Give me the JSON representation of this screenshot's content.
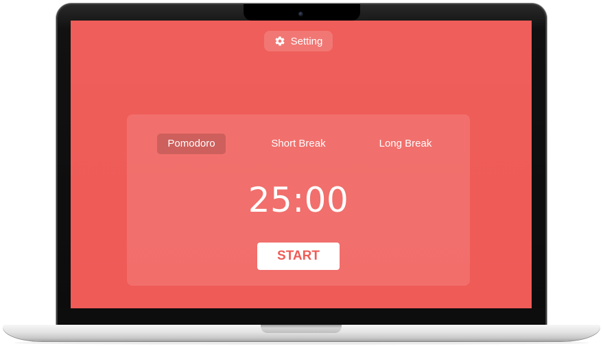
{
  "app": {
    "accent_color": "#ef5b57",
    "setting_label": "Setting",
    "setting_icon": "gear-icon"
  },
  "timer": {
    "tabs": [
      {
        "label": "Pomodoro",
        "active": true
      },
      {
        "label": "Short Break",
        "active": false
      },
      {
        "label": "Long Break",
        "active": false
      }
    ],
    "time": "25:00",
    "start_label": "START"
  }
}
